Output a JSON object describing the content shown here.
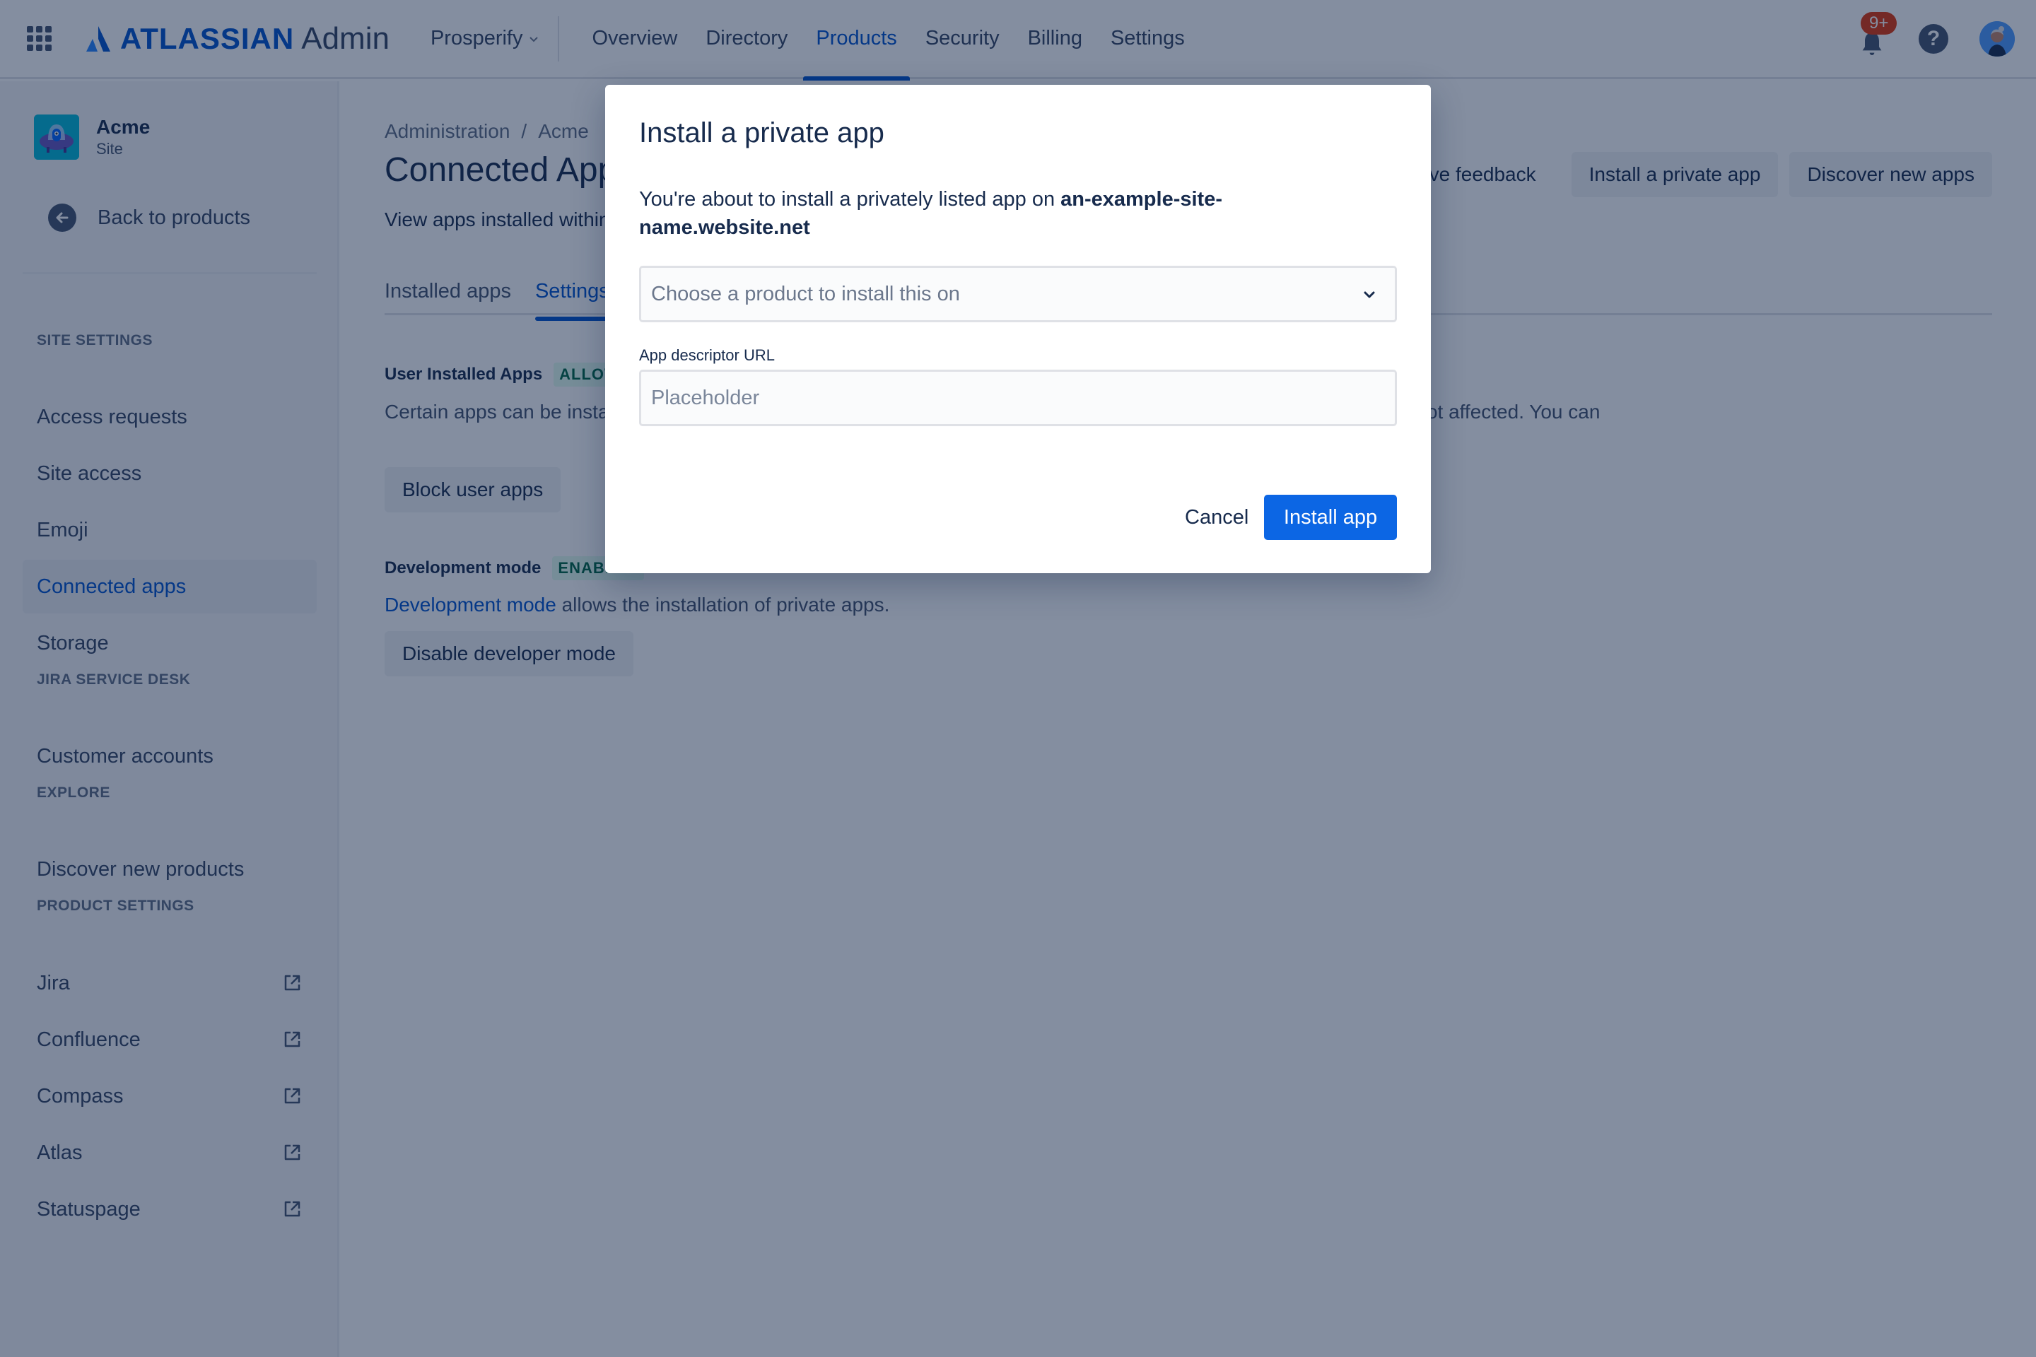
{
  "topnav": {
    "logo_word": "ATLASSIAN",
    "logo_suffix": "Admin",
    "site_switcher": "Prosperify",
    "items": [
      {
        "label": "Overview",
        "active": false
      },
      {
        "label": "Directory",
        "active": false
      },
      {
        "label": "Products",
        "active": true
      },
      {
        "label": "Security",
        "active": false
      },
      {
        "label": "Billing",
        "active": false
      },
      {
        "label": "Settings",
        "active": false
      }
    ],
    "notifications_badge": "9+",
    "help_glyph": "?",
    "icons": {
      "app_switcher": "app-switcher-icon",
      "notifications": "bell-icon",
      "help": "help-icon",
      "avatar": "user-avatar"
    }
  },
  "sidebar": {
    "site_name": "Acme",
    "site_type": "Site",
    "back_label": "Back to products",
    "sections": [
      {
        "title": "SITE SETTINGS",
        "items": [
          {
            "label": "Access requests",
            "active": false
          },
          {
            "label": "Site access",
            "active": false
          },
          {
            "label": "Emoji",
            "active": false
          },
          {
            "label": "Connected apps",
            "active": true
          },
          {
            "label": "Storage",
            "active": false
          }
        ]
      },
      {
        "title": "JIRA SERVICE DESK",
        "items": [
          {
            "label": "Customer accounts",
            "active": false
          }
        ]
      },
      {
        "title": "EXPLORE",
        "items": [
          {
            "label": "Discover new products",
            "active": false
          }
        ]
      },
      {
        "title": "PRODUCT SETTINGS",
        "items": [
          {
            "label": "Jira",
            "external": true
          },
          {
            "label": "Confluence",
            "external": true
          },
          {
            "label": "Compass",
            "external": true
          },
          {
            "label": "Atlas",
            "external": true
          },
          {
            "label": "Statuspage",
            "external": true
          }
        ]
      }
    ]
  },
  "main": {
    "breadcrumb": [
      "Administration",
      "Acme"
    ],
    "breadcrumb_sep": "/",
    "title": "Connected Apps",
    "description": "View apps installed within your site.",
    "feedback_label": "Give feedback",
    "install_private_label": "Install a private app",
    "discover_label": "Discover new apps",
    "tabs": [
      {
        "label": "Installed apps",
        "active": false
      },
      {
        "label": "Settings",
        "active": true
      }
    ],
    "user_installed": {
      "title": "User Installed Apps",
      "status": "ALLOWED",
      "description": "Certain apps can be installed by users. You can block users from installing new apps. Existing user installed apps are not affected. You can",
      "button": "Block user apps"
    },
    "development_mode": {
      "title": "Development mode",
      "status": "ENABLED",
      "link_text": "Development mode",
      "description": " allows the installation of private apps.",
      "button": "Disable developer mode"
    }
  },
  "modal": {
    "title": "Install a private app",
    "body_prefix": "You're about to install a privately listed app on ",
    "site_url": "an-example-site-name.website.net",
    "product_select_placeholder": "Choose a product to install this on",
    "url_label": "App descriptor URL",
    "url_placeholder": "Placeholder",
    "url_value": "",
    "cancel_label": "Cancel",
    "install_label": "Install app"
  },
  "colors": {
    "brand": "#0052cc",
    "primary_button": "#0c66e4",
    "badge_red": "#de350b",
    "lozenge_green_bg": "#e3fcef",
    "lozenge_green_text": "#006644",
    "overlay": "rgba(9,30,66,0.50)"
  }
}
